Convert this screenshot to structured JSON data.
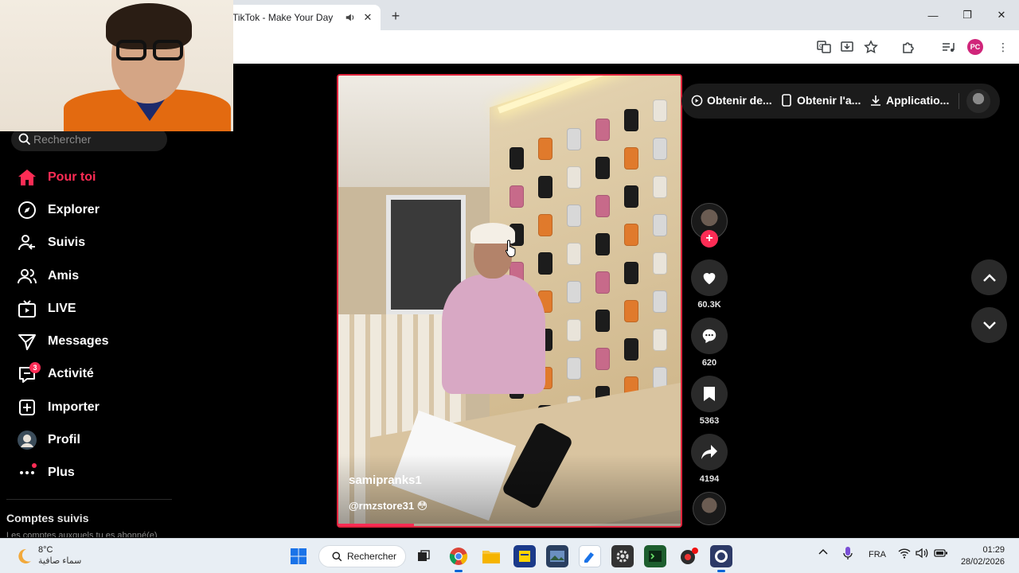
{
  "browser": {
    "tab_title": "TikTok - Make Your Day",
    "profile_initials": "PC",
    "window_controls": [
      "minimize",
      "restore",
      "close"
    ]
  },
  "sidebar": {
    "search_placeholder": "Rechercher",
    "items": [
      {
        "label": "Pour toi",
        "icon": "home-icon",
        "active": true
      },
      {
        "label": "Explorer",
        "icon": "compass-icon"
      },
      {
        "label": "Suivis",
        "icon": "following-icon"
      },
      {
        "label": "Amis",
        "icon": "friends-icon"
      },
      {
        "label": "LIVE",
        "icon": "live-tv-icon"
      },
      {
        "label": "Messages",
        "icon": "send-icon"
      },
      {
        "label": "Activité",
        "icon": "activity-icon",
        "badge": "3"
      },
      {
        "label": "Importer",
        "icon": "upload-icon"
      },
      {
        "label": "Profil",
        "icon": "profile-avatar-icon"
      },
      {
        "label": "Plus",
        "icon": "more-dots-icon"
      }
    ],
    "followed_title": "Comptes suivis",
    "followed_subtitle": "Les comptes auxquels tu es abonné(e)"
  },
  "video": {
    "username": "samipranks1",
    "caption": "@rmzstore31 😳",
    "progress_fraction": 0.22
  },
  "actions": {
    "likes": "60.3K",
    "comments": "620",
    "saves": "5363",
    "shares": "4194"
  },
  "topbar": {
    "coins": "Obtenir de...",
    "app": "Obtenir l'a...",
    "download": "Applicatio..."
  },
  "taskbar": {
    "weather_temp": "8°C",
    "weather_desc": "سماء صافية",
    "search_label": "Rechercher",
    "language": "FRA",
    "time": "01:29",
    "date": "28/02/2026"
  },
  "colors": {
    "accent": "#fe2c55",
    "video_border": "#e0243d",
    "background": "#000000"
  }
}
